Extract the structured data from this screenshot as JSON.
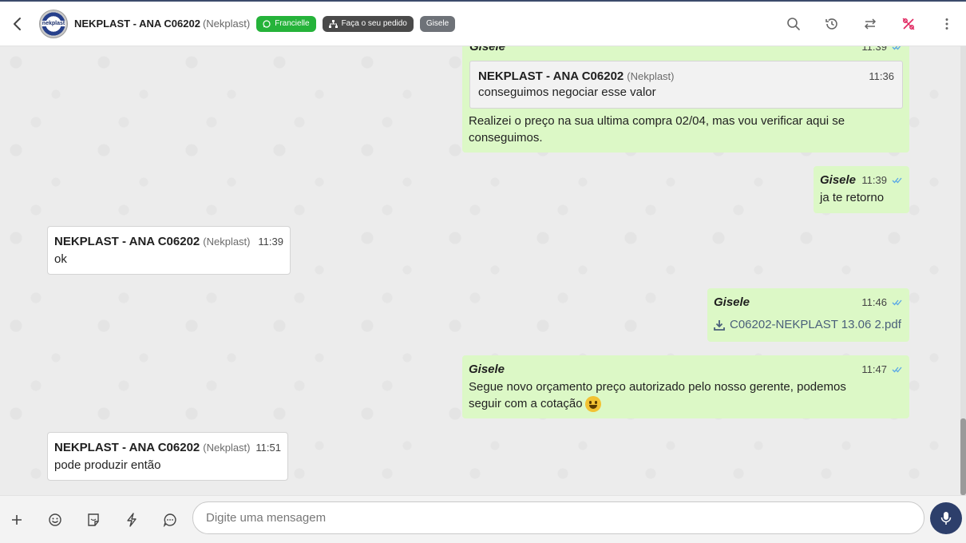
{
  "header": {
    "contact_name": "NEKPLAST - ANA C06202",
    "contact_company": "(Nekplast)",
    "avatar_text": "nekplast",
    "tags": [
      {
        "label": "Francielle",
        "color": "#25b33a"
      },
      {
        "label": "Faça o seu pedido",
        "color": "#4a4a4a"
      },
      {
        "label": "Gisele",
        "color": "#6e7278"
      }
    ],
    "icons": [
      "search-icon",
      "history-icon",
      "transfer-icon",
      "no-sales-icon",
      "more-icon"
    ]
  },
  "messages": [
    {
      "direction": "out",
      "sender": "Gisele",
      "time": "11:39",
      "quote": {
        "sender": "NEKPLAST - ANA C06202",
        "company": "(Nekplast)",
        "time": "11:36",
        "text": "conseguimos negociar esse valor"
      },
      "text": "Realizei o preço na sua ultima compra 02/04, mas vou verificar aqui se conseguimos."
    },
    {
      "direction": "out",
      "sender": "Gisele",
      "time": "11:39",
      "text": "ja te retorno"
    },
    {
      "direction": "in",
      "sender": "NEKPLAST - ANA C06202",
      "company": "(Nekplast)",
      "time": "11:39",
      "text": "ok"
    },
    {
      "direction": "out",
      "sender": "Gisele",
      "time": "11:46",
      "file": "C06202-NEKPLAST 13.06 2.pdf"
    },
    {
      "direction": "out",
      "sender": "Gisele",
      "time": "11:47",
      "text_line1": "Segue novo orçamento preço autorizado pelo nosso gerente, podemos",
      "text_line2": "seguir com a cotação"
    },
    {
      "direction": "in",
      "sender": "NEKPLAST - ANA C06202",
      "company": "(Nekplast)",
      "time": "11:51",
      "text": "pode produzir então"
    }
  ],
  "composer": {
    "placeholder": "Digite uma mensagem",
    "icons": [
      "plus-icon",
      "emoji-icon",
      "sticker-icon",
      "lightning-icon",
      "chat-icon",
      "mic-icon"
    ]
  },
  "colors": {
    "outgoing_bubble": "#dcf8c6",
    "incoming_bubble": "#ffffff",
    "tick_color": "#5aa7e6",
    "mic_button": "#2d3f6b"
  }
}
